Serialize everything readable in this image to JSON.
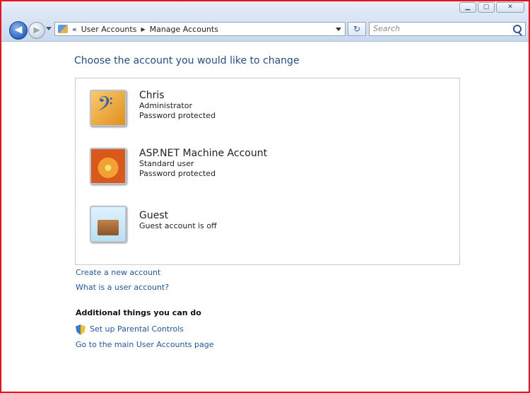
{
  "window": {
    "minimize": "▁",
    "maximize": "▢",
    "close": "✕"
  },
  "address": {
    "crumbs": [
      "User Accounts",
      "Manage Accounts"
    ],
    "prefix": "«"
  },
  "search": {
    "placeholder": "Search"
  },
  "page": {
    "title": "Choose the account you would like to change"
  },
  "accounts": [
    {
      "name": "Chris",
      "lines": [
        "Administrator",
        "Password protected"
      ],
      "icon": "bass-clef-icon"
    },
    {
      "name": "ASP.NET Machine Account",
      "lines": [
        "Standard user",
        "Password protected"
      ],
      "icon": "flower-icon"
    },
    {
      "name": "Guest",
      "lines": [
        "Guest account is off"
      ],
      "icon": "briefcase-icon"
    }
  ],
  "links": {
    "create": "Create a new account",
    "what": "What is a user account?"
  },
  "additional": {
    "heading": "Additional things you can do",
    "parental": "Set up Parental Controls",
    "main": "Go to the main User Accounts page"
  },
  "colors": {
    "accent": "#1f4e8c",
    "link": "#1f57a8",
    "border": "#e8141b"
  }
}
